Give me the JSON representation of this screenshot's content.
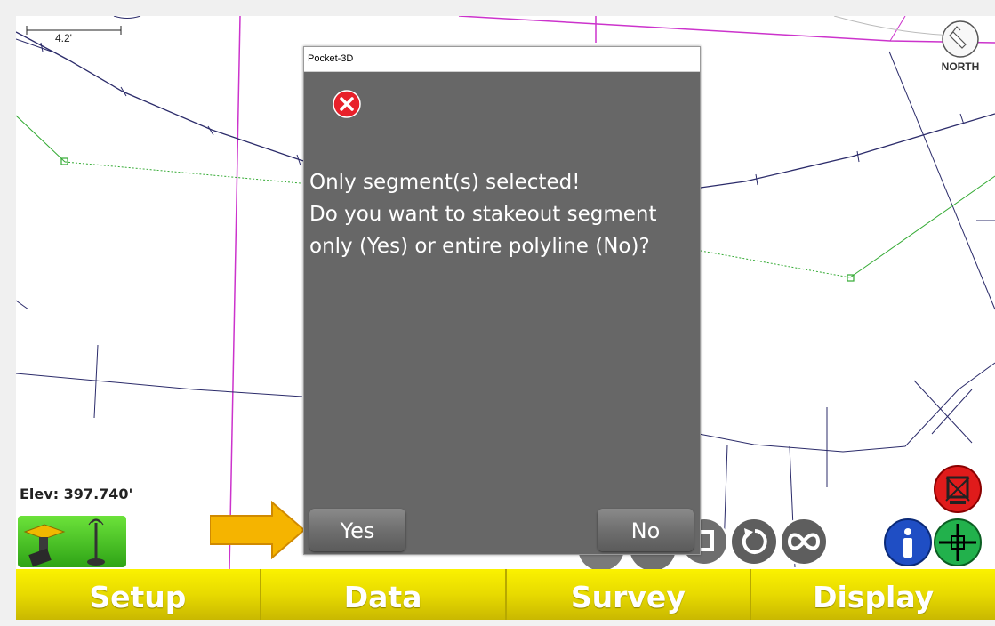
{
  "map": {
    "scale_label": "4.2'",
    "north_label": "NORTH",
    "elevation": "Elev: 397.740'"
  },
  "dialog": {
    "title": "Pocket-3D",
    "icon": "error-icon",
    "message_line1": "Only segment(s) selected!",
    "message_line2": "Do you want to stakeout segment",
    "message_line3": "only (Yes) or entire polyline (No)?",
    "yes_label": "Yes",
    "no_label": "No"
  },
  "toolbar": {
    "setup_label": "Setup",
    "data_label": "Data",
    "survey_label": "Survey",
    "display_label": "Display"
  },
  "colors": {
    "toolbar_yellow": "#e7da00",
    "dialog_gray": "#676767",
    "gnss_green": "#4cc62a",
    "arrow_orange": "#f5b400",
    "info_blue": "#1f4ec4",
    "crosshair_green": "#22b14c",
    "stop_red": "#e01b1b",
    "polyline_navy": "#2b2b6a",
    "line_magenta": "#cc33cc",
    "boundary_green": "#33aa33"
  },
  "icons": {
    "north": "north-compass-icon",
    "gnss": "gnss-receiver-icon",
    "arrow": "pointer-arrow-icon",
    "info": "info-icon",
    "crosshair": "crosshair-icon",
    "stop": "stop-measure-icon",
    "zoom": "zoom-icon",
    "rotate": "rotate-icon",
    "infinity": "infinity-icon"
  }
}
